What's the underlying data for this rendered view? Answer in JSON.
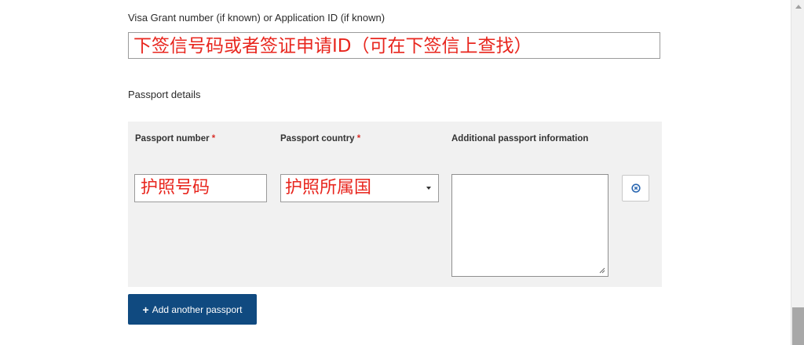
{
  "visa": {
    "label": "Visa Grant number (if known) or Application ID (if known)",
    "value": "下签信号码或者签证申请ID（可在下签信上查找）"
  },
  "passport_section": {
    "title": "Passport details",
    "columns": {
      "number_label": "Passport number",
      "country_label": "Passport country",
      "additional_label": "Additional passport information",
      "required_mark": "*"
    },
    "number_value": "护照号码",
    "country_value": "护照所属国",
    "additional_value": ""
  },
  "buttons": {
    "add_passport_label": "Add another passport",
    "add_icon": "+",
    "remove_icon": "remove-circle-icon"
  },
  "colors": {
    "annotation_text": "#e8261e",
    "primary_button": "#104a80",
    "panel_bg": "#f1f1f1",
    "remove_icon": "#2a67b1"
  }
}
